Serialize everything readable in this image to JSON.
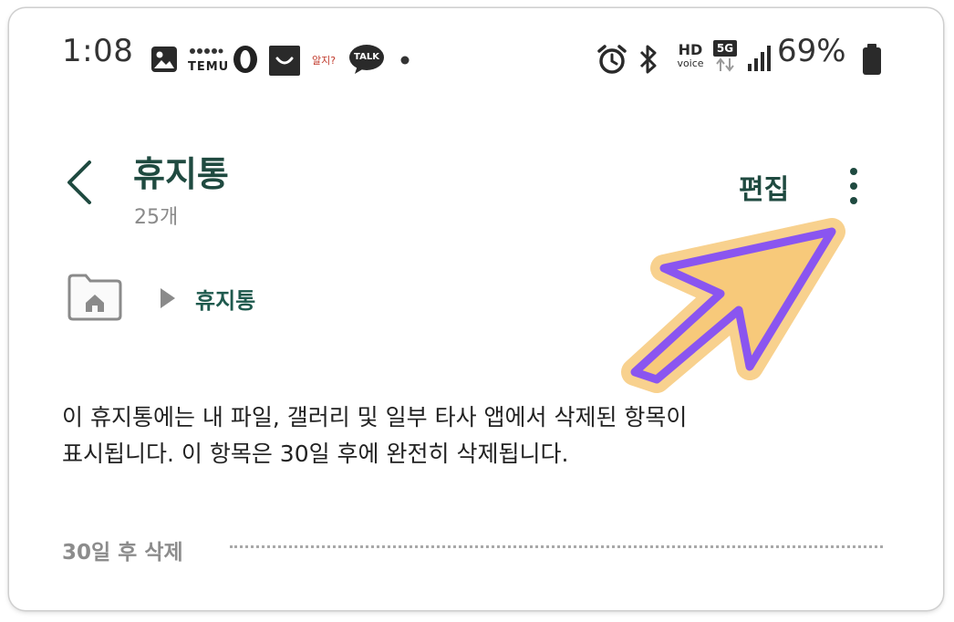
{
  "status_bar": {
    "time": "1:08",
    "app_temu_label": "TEMU",
    "app_small_label": "알지?",
    "app_talk_label": "TALK",
    "hd_label": "HD",
    "voice_label": "voice",
    "network_label": "5G",
    "battery_percent": "69%"
  },
  "header": {
    "title": "휴지통",
    "count": "25개",
    "edit_label": "편집"
  },
  "breadcrumb": {
    "current": "휴지통"
  },
  "info_text": {
    "line1": "이 휴지통에는 내 파일, 갤러리 및 일부 타사 앱에서 삭제된 항목이",
    "line2": "표시됩니다. 이 항목은 30일 후에 완전히 삭제됩니다."
  },
  "section": {
    "label": "30일 후 삭제"
  },
  "colors": {
    "accent_green": "#1f4a40",
    "annotation_arrow_fill": "#f7c97a",
    "annotation_arrow_stroke": "#8a55f0"
  }
}
